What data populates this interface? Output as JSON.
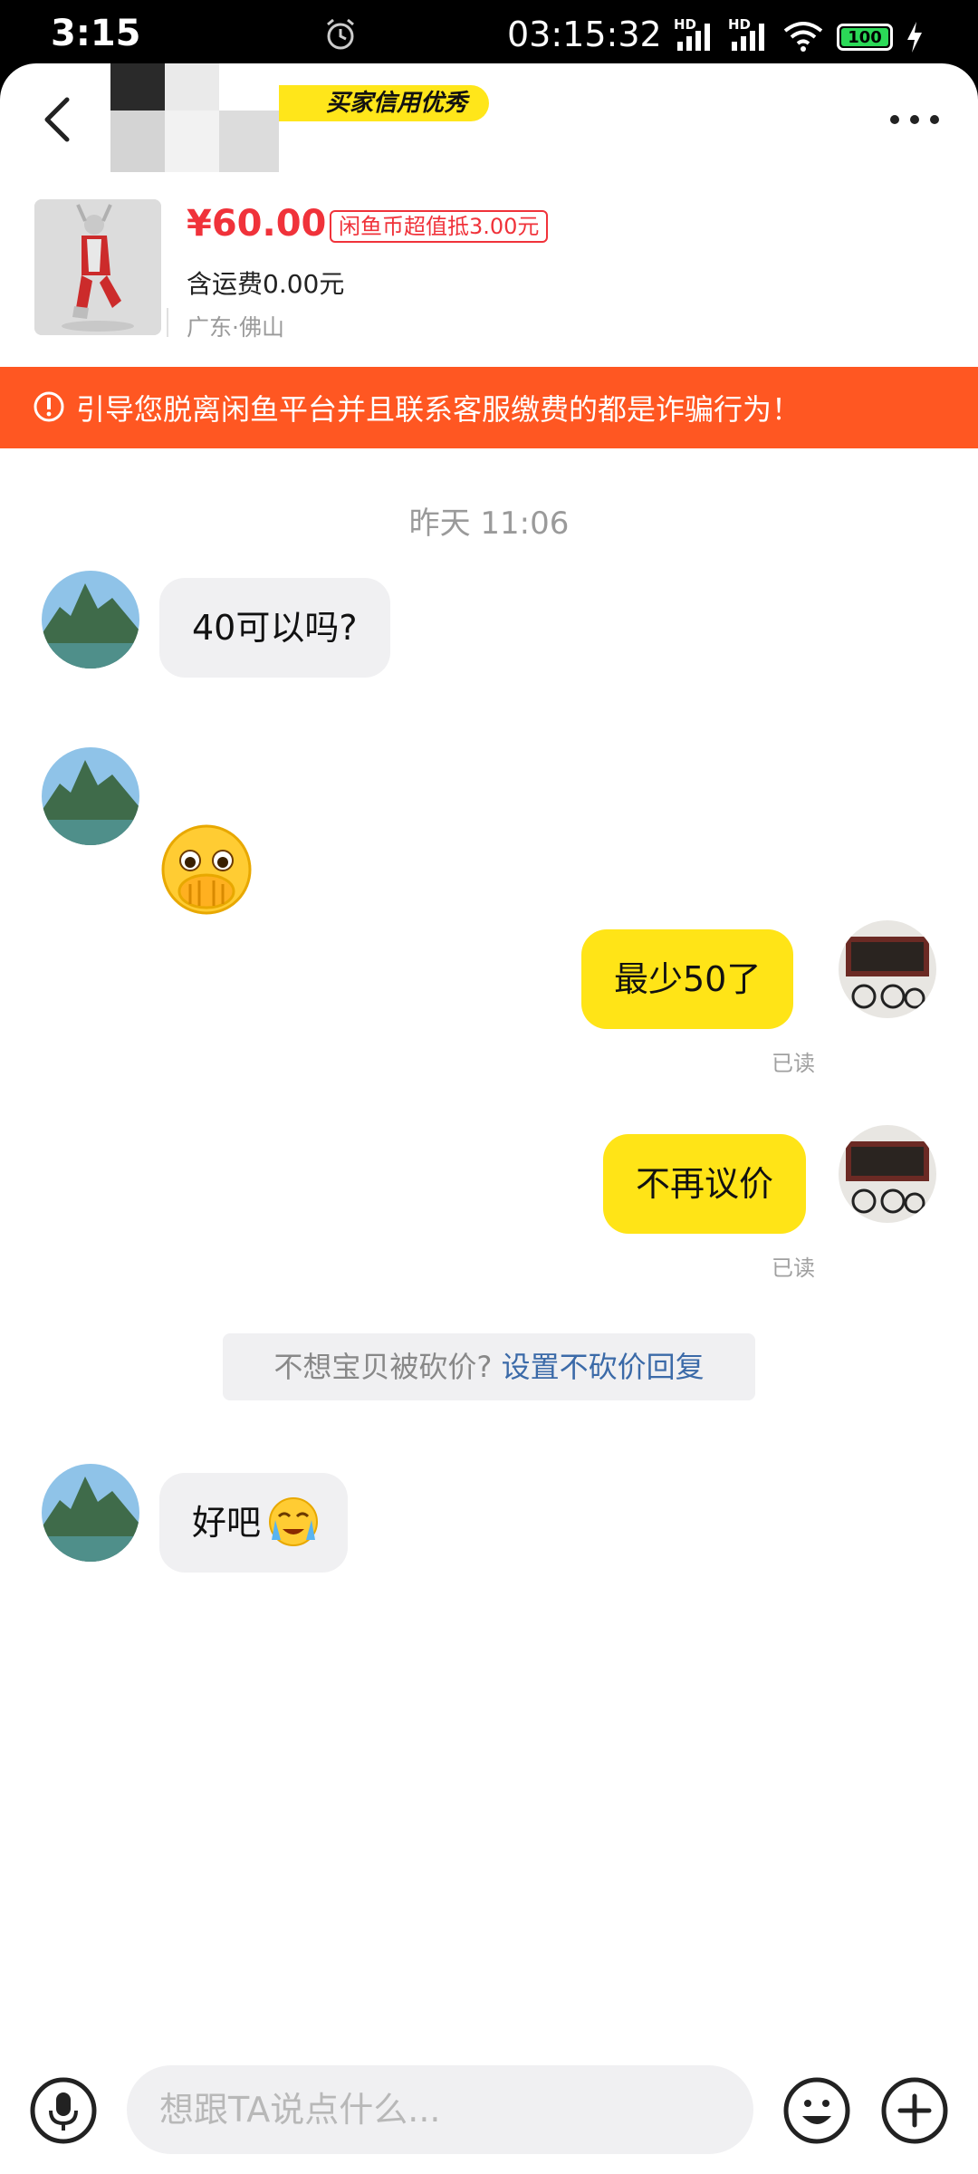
{
  "status_bar": {
    "time_left": "3:15",
    "time": "03:15:32",
    "hd1": "HD",
    "hd2": "HD",
    "battery": "100"
  },
  "header": {
    "credit_badge": "买家信用优秀"
  },
  "product": {
    "price": "¥60.00",
    "coin_tag": "闲鱼币超值抵3.00元",
    "shipping": "含运费0.00元",
    "location": "广东·佛山"
  },
  "warning": {
    "text": "引导您脱离闲鱼平台并且联系客服缴费的都是诈骗行为！"
  },
  "chat": {
    "timestamp": "昨天 11:06",
    "messages": [
      {
        "text": "40可以吗?"
      },
      {
        "text": ""
      },
      {
        "text": "最少50了",
        "status": "已读"
      },
      {
        "text": "不再议价",
        "status": "已读"
      },
      {
        "text": "好吧"
      }
    ],
    "no_bargain_prompt": "不想宝贝被砍价?",
    "no_bargain_link": "设置不砍价回复"
  },
  "input": {
    "placeholder": "想跟TA说点什么..."
  },
  "colors": {
    "accent_yellow": "#ffe417",
    "warning_orange": "#ff5722",
    "price_red": "#f0323a",
    "link_blue": "#3b6aa8"
  },
  "icons": [
    "alarm-icon",
    "signal-icon",
    "wifi-icon",
    "battery-icon",
    "charging-icon",
    "back-arrow-icon",
    "more-dots-icon",
    "warning-icon",
    "microphone-icon",
    "emoji-icon",
    "plus-icon"
  ]
}
